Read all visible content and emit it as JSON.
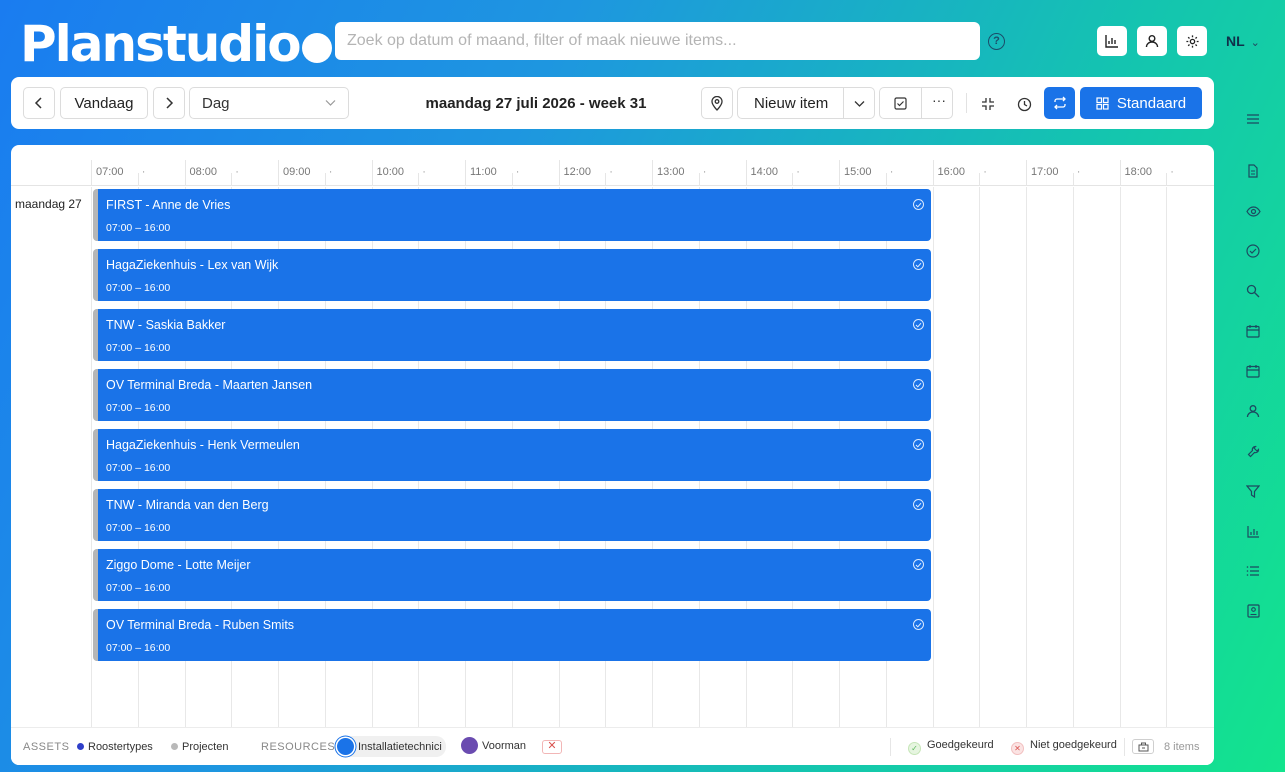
{
  "header": {
    "logo": "Planstudio",
    "search_placeholder": "Zoek op datum of maand, filter of maak nieuwe items...",
    "language": "NL",
    "help_icon": "question-circle-icon",
    "buttons": [
      "chart-icon",
      "user-icon",
      "gear-icon"
    ]
  },
  "toolbar": {
    "today_label": "Vandaag",
    "view_selected": "Dag",
    "date_title": "maandag 27 juli 2026 - week 31",
    "new_item_label": "Nieuw item",
    "standard_label": "Standaard"
  },
  "calendar": {
    "hours": [
      "07:00",
      "08:00",
      "09:00",
      "10:00",
      "11:00",
      "12:00",
      "13:00",
      "14:00",
      "15:00",
      "16:00",
      "17:00",
      "18:00"
    ],
    "half_marker": "·",
    "day_label": "maandag 27",
    "events": [
      {
        "title": "FIRST - Anne de Vries",
        "time": "07:00 – 16:00"
      },
      {
        "title": "HagaZiekenhuis - Lex van Wijk",
        "time": "07:00 – 16:00"
      },
      {
        "title": "TNW - Saskia Bakker",
        "time": "07:00 – 16:00"
      },
      {
        "title": "OV Terminal Breda - Maarten Jansen",
        "time": "07:00 – 16:00"
      },
      {
        "title": "HagaZiekenhuis - Henk Vermeulen",
        "time": "07:00 – 16:00"
      },
      {
        "title": "TNW - Miranda van den Berg",
        "time": "07:00 – 16:00"
      },
      {
        "title": "Ziggo Dome - Lotte Meijer",
        "time": "07:00 – 16:00"
      },
      {
        "title": "OV Terminal Breda - Ruben Smits",
        "time": "07:00 – 16:00"
      }
    ]
  },
  "footer": {
    "assets_caption": "ASSETS",
    "roostertypes": "Roostertypes",
    "projecten": "Projecten",
    "resources_caption": "RESOURCES",
    "installatietechnici": "Installatietechnici",
    "voorman": "Voorman",
    "approved": "Goedgekeurd",
    "not_approved": "Niet goedgekeurd",
    "items_count": "8 items"
  },
  "colors": {
    "accent": "#1a73e8",
    "voorman": "#6a4bb0",
    "approved": "#5cb85c",
    "not_approved": "#d9534f"
  },
  "rail_icons": [
    "menu-icon",
    "document-icon",
    "eye-icon",
    "check-circle-icon",
    "search-icon",
    "calendar-icon",
    "calendar-alt-icon",
    "user-icon",
    "wrench-icon",
    "filter-icon",
    "chart-icon",
    "list-icon",
    "id-card-icon"
  ]
}
